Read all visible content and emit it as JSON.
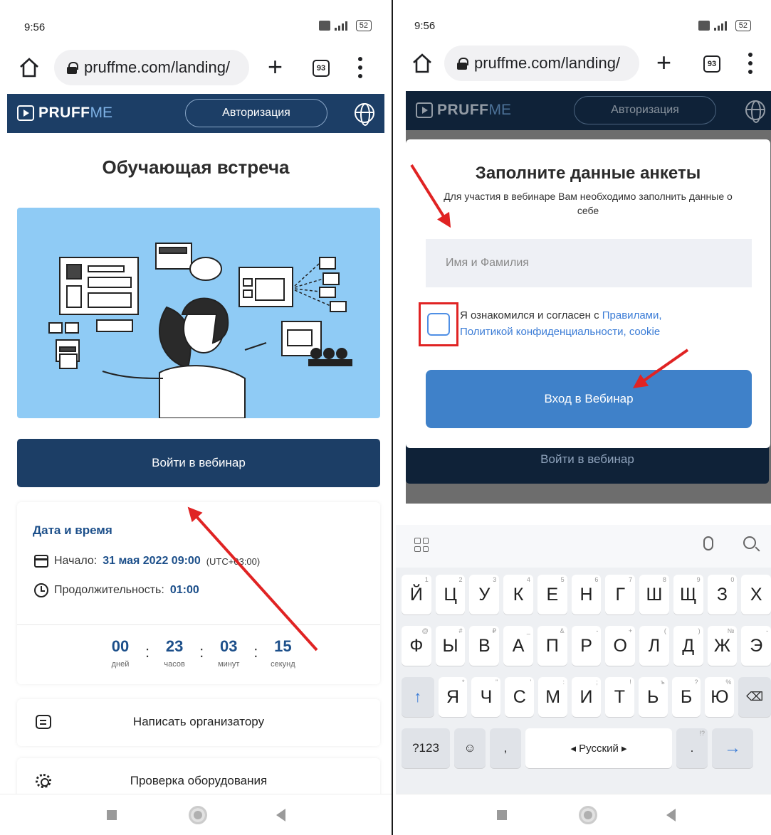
{
  "status": {
    "time": "9:56",
    "battery": "52"
  },
  "browser": {
    "url": "pruffme.com/landing/",
    "tab_count": "93"
  },
  "site": {
    "logo_part1": "PRUFF",
    "logo_part2": "ME",
    "auth_label": "Авторизация"
  },
  "left": {
    "page_title": "Обучающая встреча",
    "enter_button": "Войти в вебинар",
    "info": {
      "heading": "Дата и время",
      "start_label": "Начало:",
      "start_value": "31 мая 2022 09:00",
      "tz": "(UTC+03:00)",
      "duration_label": "Продолжительность:",
      "duration_value": "01:00"
    },
    "countdown": [
      {
        "value": "00",
        "label": "дней"
      },
      {
        "value": "23",
        "label": "часов"
      },
      {
        "value": "03",
        "label": "минут"
      },
      {
        "value": "15",
        "label": "секунд"
      }
    ],
    "actions": {
      "write_organizer": "Написать организатору",
      "check_equipment": "Проверка оборудования"
    }
  },
  "modal": {
    "title": "Заполните данные анкеты",
    "subtitle": "Для участия в вебинаре Вам необходимо заполнить данные о себе",
    "name_placeholder": "Имя и Фамилия",
    "agree_text": "Я ознакомился и согласен с ",
    "link_rules": "Правилами,",
    "link_privacy": "Политикой конфиденциальности,",
    "link_cookie": "cookie",
    "submit_button": "Вход в Вебинар",
    "behind_button": "Войти в вебинар"
  },
  "keyboard": {
    "row1": [
      "Й",
      "Ц",
      "У",
      "К",
      "Е",
      "Н",
      "Г",
      "Ш",
      "Щ",
      "З",
      "Х"
    ],
    "row1_hints": [
      "1",
      "2",
      "3",
      "4",
      "5",
      "6",
      "7",
      "8",
      "9",
      "0",
      ""
    ],
    "row2": [
      "Ф",
      "Ы",
      "В",
      "А",
      "П",
      "Р",
      "О",
      "Л",
      "Д",
      "Ж",
      "Э"
    ],
    "row2_hints": [
      "@",
      "#",
      "₽",
      "_",
      "&",
      "-",
      "+",
      "(",
      ")",
      "№",
      "-"
    ],
    "row3": [
      "Я",
      "Ч",
      "С",
      "М",
      "И",
      "Т",
      "Ь",
      "Б",
      "Ю"
    ],
    "row3_hints": [
      "*",
      "\"",
      "'",
      ":",
      ";",
      "!",
      "ъ",
      "?",
      "%"
    ],
    "symbols_key": "?123",
    "comma": ",",
    "space_label": "◂ Русский ▸",
    "period": ".",
    "period_hint": "!?"
  },
  "colors": {
    "brand_dark": "#1c3e66",
    "brand_blue": "#3f81c9",
    "annotation_red": "#e02323"
  }
}
